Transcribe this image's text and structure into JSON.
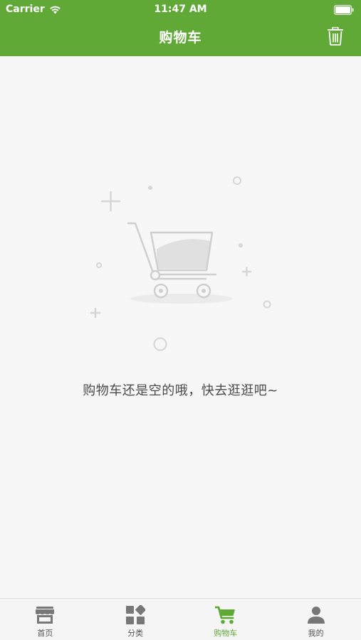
{
  "status_bar": {
    "carrier": "Carrier",
    "time": "11:47 AM",
    "wifi_icon": "wifi-icon",
    "battery_icon": "battery-icon"
  },
  "nav_bar": {
    "title": "购物车",
    "background_color": "#61a937",
    "trash_icon": "trash-icon"
  },
  "empty_state": {
    "illustration_icon": "empty-cart-illustration",
    "message": "购物车还是空的哦，快去逛逛吧~"
  },
  "tab_bar": {
    "active_color": "#61a937",
    "inactive_color": "#777777",
    "tabs": [
      {
        "label": "首页",
        "icon": "store-icon",
        "active": false
      },
      {
        "label": "分类",
        "icon": "category-grid-icon",
        "active": false
      },
      {
        "label": "购物车",
        "icon": "cart-icon",
        "active": true
      },
      {
        "label": "我的",
        "icon": "person-icon",
        "active": false
      }
    ]
  }
}
